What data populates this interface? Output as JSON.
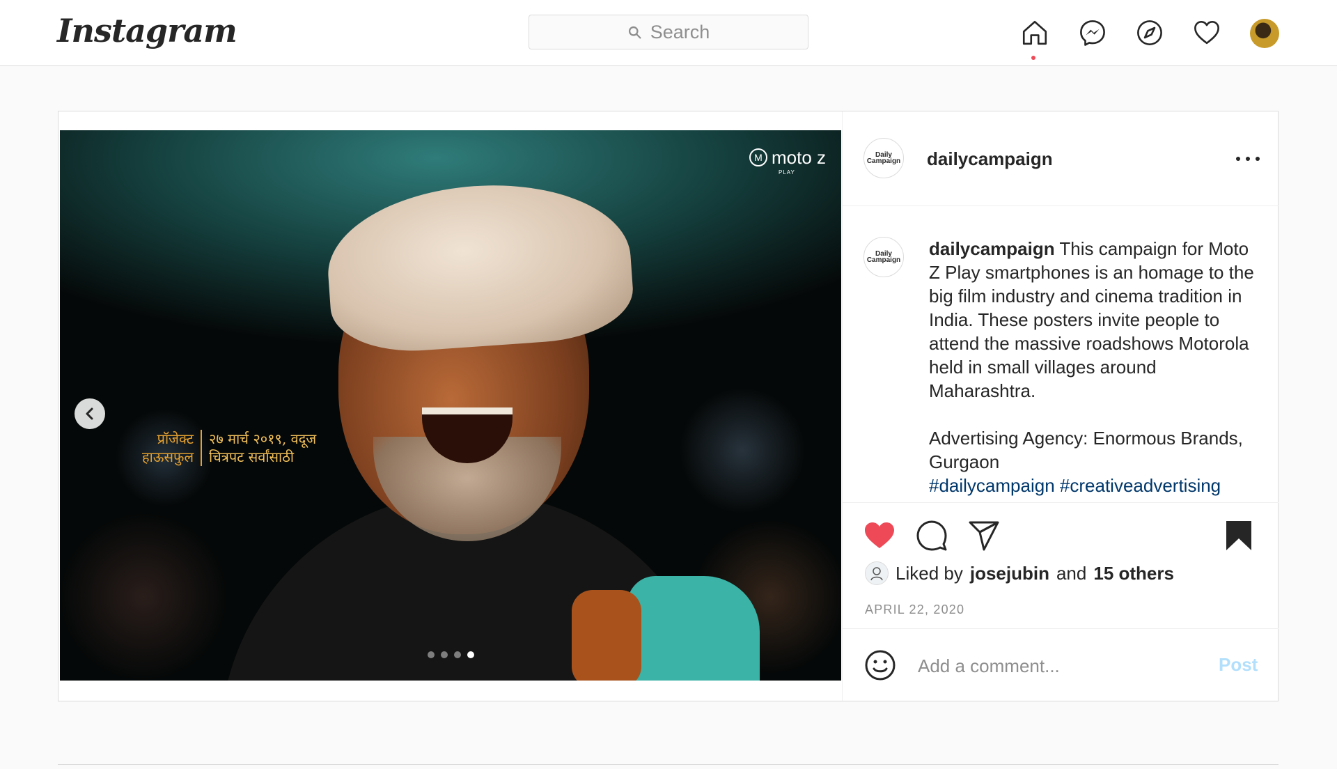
{
  "nav": {
    "logo": "Instagram",
    "search_placeholder": "Search",
    "icons": [
      "home-icon",
      "messenger-icon",
      "explore-icon",
      "activity-heart-icon",
      "profile-avatar"
    ],
    "active_dot_color": "#ed4956"
  },
  "post": {
    "username": "dailycampaign",
    "avatar_text": "Daily Campaign",
    "image": {
      "brand_logo": "moto z",
      "brand_sub": "PLAY",
      "poster_line1_left": "प्रॉजेक्ट",
      "poster_line2_left": "हाऊसफुल",
      "poster_line1_right": "२७ मार्च २०१९, वदूज",
      "poster_line2_right": "चित्रपट सर्वांसाठी",
      "carousel_total": 4,
      "carousel_active": 4
    },
    "caption": {
      "username": "dailycampaign",
      "text": "This campaign for Moto Z Play smartphones is an homage to the big film industry and cinema tradition in India. These posters invite people to attend the massive roadshows Motorola held in small villages around Maharashtra.",
      "agency": "Advertising Agency: Enormous Brands, Gurgaon",
      "hashtags": [
        "#dailycampaign",
        "#creativeadvertising"
      ]
    },
    "likes": {
      "prefix": "Liked by",
      "user": "josejubin",
      "and": "and",
      "others": "15 others"
    },
    "date": "APRIL 22, 2020",
    "comment": {
      "placeholder": "Add a comment...",
      "post_label": "Post"
    },
    "colors": {
      "liked_heart": "#ed4956",
      "hashtag": "#00376b",
      "post_button_disabled": "#b2dffc"
    }
  }
}
